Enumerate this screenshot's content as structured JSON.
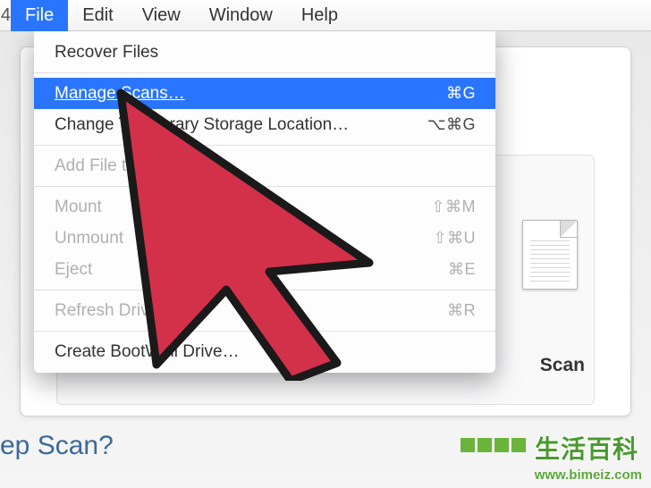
{
  "menubar": {
    "left_trunc": "4",
    "items": [
      "File",
      "Edit",
      "View",
      "Window",
      "Help"
    ],
    "active_index": 0
  },
  "dropdown": {
    "sections": [
      [
        {
          "label": "Recover Files",
          "shortcut": "",
          "disabled": false,
          "highlighted": false
        }
      ],
      [
        {
          "label": "Manage Scans…",
          "shortcut": "⌘G",
          "disabled": false,
          "highlighted": true
        },
        {
          "label": "Change Temporary Storage Location…",
          "shortcut": "⌥⌘G",
          "disabled": false,
          "highlighted": false
        }
      ],
      [
        {
          "label": "Add File to Scan",
          "shortcut": "",
          "disabled": true,
          "highlighted": false
        }
      ],
      [
        {
          "label": "Mount",
          "shortcut": "⇧⌘M",
          "disabled": true,
          "highlighted": false
        },
        {
          "label": "Unmount",
          "shortcut": "⇧⌘U",
          "disabled": true,
          "highlighted": false
        },
        {
          "label": "Eject",
          "shortcut": "⌘E",
          "disabled": true,
          "highlighted": false
        }
      ],
      [
        {
          "label": "Refresh Drives List",
          "shortcut": "⌘R",
          "disabled": true,
          "highlighted": false
        }
      ],
      [
        {
          "label": "Create BootWell Drive…",
          "shortcut": "",
          "disabled": false,
          "highlighted": false
        }
      ]
    ]
  },
  "background": {
    "scan_label": "Scan",
    "question_fragment": "ep Scan?"
  },
  "watermark": {
    "cn": "生活百科",
    "url": "www.bimeiz.com"
  },
  "colors": {
    "highlight": "#2a75ff",
    "arrow_fill": "#d3314a",
    "arrow_stroke": "#1a1a1a"
  }
}
